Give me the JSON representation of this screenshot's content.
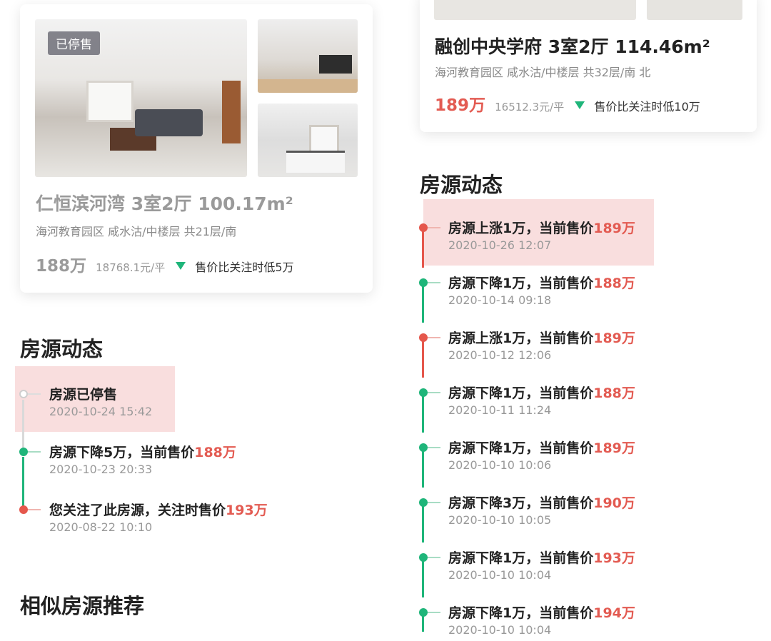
{
  "left": {
    "card": {
      "tag": "已停售",
      "title": "仁恒滨河湾 3室2厅 100.17m²",
      "subtitle": "海河教育园区 咸水沽/中楼层 共21层/南",
      "price": "188万",
      "unit_price": "18768.1元/平",
      "note": "售价比关注时低5万"
    },
    "dynamics_title": "房源动态",
    "events": [
      {
        "text": "房源已停售",
        "price": "",
        "time": "2020-10-24 15:42",
        "kind": "stopped"
      },
      {
        "text": "房源下降5万，当前售价",
        "price": "188万",
        "time": "2020-10-23 20:33",
        "kind": "down"
      },
      {
        "text": "您关注了此房源，关注时售价",
        "price": "193万",
        "time": "2020-08-22 10:10",
        "kind": "follow"
      }
    ],
    "similar_title": "相似房源推荐"
  },
  "right": {
    "card": {
      "title": "融创中央学府 3室2厅 114.46m²",
      "subtitle": "海河教育园区 咸水沽/中楼层 共32层/南 北",
      "price": "189万",
      "unit_price": "16512.3元/平",
      "note": "售价比关注时低10万"
    },
    "dynamics_title": "房源动态",
    "events": [
      {
        "text": "房源上涨1万，当前售价",
        "price": "189万",
        "time": "2020-10-26 12:07",
        "kind": "up"
      },
      {
        "text": "房源下降1万，当前售价",
        "price": "188万",
        "time": "2020-10-14 09:18",
        "kind": "down"
      },
      {
        "text": "房源上涨1万，当前售价",
        "price": "189万",
        "time": "2020-10-12 12:06",
        "kind": "up"
      },
      {
        "text": "房源下降1万，当前售价",
        "price": "188万",
        "time": "2020-10-11 11:24",
        "kind": "down"
      },
      {
        "text": "房源下降1万，当前售价",
        "price": "189万",
        "time": "2020-10-10 10:06",
        "kind": "down"
      },
      {
        "text": "房源下降3万，当前售价",
        "price": "190万",
        "time": "2020-10-10 10:05",
        "kind": "down"
      },
      {
        "text": "房源下降1万，当前售价",
        "price": "193万",
        "time": "2020-10-10 10:04",
        "kind": "down"
      },
      {
        "text": "房源下降1万，当前售价",
        "price": "194万",
        "time": "2020-10-10 10:04",
        "kind": "down"
      }
    ]
  },
  "colors": {
    "accent_red": "#e35b52",
    "accent_green": "#1fb57a",
    "highlight": "#f9dede"
  }
}
